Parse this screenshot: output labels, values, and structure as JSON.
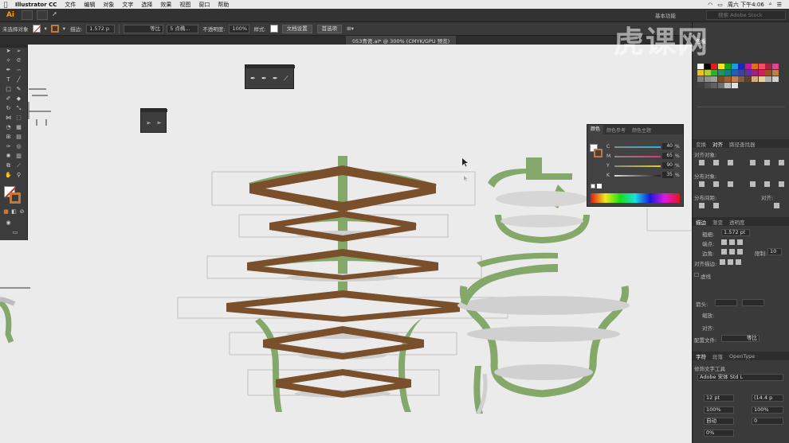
{
  "menubar": {
    "apple": "",
    "app_name": "Illustrator CC",
    "items": [
      "文件",
      "编辑",
      "对象",
      "文字",
      "选择",
      "效果",
      "视图",
      "窗口",
      "帮助"
    ],
    "clock": "周六 下午4:06"
  },
  "appbar": {
    "logo": "Ai",
    "workspace": "基本功能",
    "stock_search_placeholder": "搜索 Adobe Stock"
  },
  "controlbar": {
    "selection_status": "未选择对象",
    "stroke_label": "描边:",
    "stroke_value": "1.572 p",
    "stroke_profile": "等比",
    "brush": "5 点椭...",
    "opacity_label": "不透明度:",
    "opacity_value": "100%",
    "style_label": "样式:",
    "doc_setup_button": "文档设置",
    "prefs_button": "首选项"
  },
  "document": {
    "tab_title": "053青瓷.ai* @ 300% (CMYK/GPU 预览)"
  },
  "colors": {
    "brown": "#7a4f2c",
    "green": "#84a86a",
    "shadow": "#cfcfcf",
    "canvas": "#ebebeb",
    "accent_orange": "#ff9a00"
  },
  "color_panel": {
    "tabs": [
      "颜色",
      "颜色参考",
      "颜色主题"
    ],
    "channels": [
      {
        "name": "C",
        "value": "40",
        "color": "#2bb3d8"
      },
      {
        "name": "M",
        "value": "65",
        "color": "#d8357a"
      },
      {
        "name": "Y",
        "value": "90",
        "color": "#d8cf2b"
      },
      {
        "name": "K",
        "value": "35",
        "color": "#444444"
      }
    ],
    "unit": "%"
  },
  "swatches_panel": {
    "title": "色板"
  },
  "align_panel": {
    "tabs": [
      "变换",
      "对齐",
      "路径查找器"
    ],
    "align_objects": "对齐对象:",
    "distribute_objects": "分布对象:",
    "distribute_spacing": "分布间距:",
    "align_to": "对齐:"
  },
  "stroke_panel": {
    "tabs": [
      "描边",
      "渐变",
      "透明度"
    ],
    "weight_label": "粗细:",
    "weight_value": "1.572 pt",
    "cap_label": "端点:",
    "corner_label": "边角:",
    "miter_label": "限制:",
    "miter_value": "10",
    "align_stroke_label": "对齐描边:",
    "dashed_label": "虚线",
    "arrowheads_label": "箭头:",
    "scale_label": "缩放:",
    "align_label": "对齐:",
    "profile_label": "配置文件:",
    "profile_value": "等比"
  },
  "type_panel": {
    "tabs": [
      "字符",
      "段落",
      "OpenType"
    ],
    "touch_type": "修饰文字工具",
    "font": "Adobe 宋体 Std L",
    "size": "12 pt",
    "leading": "(14.4 p",
    "h_scale": "100%",
    "v_scale": "100%",
    "kerning": "自动",
    "tracking": "0",
    "baseline": "0%"
  }
}
